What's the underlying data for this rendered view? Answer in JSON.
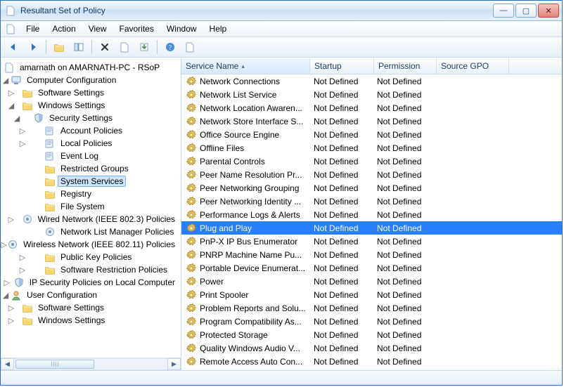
{
  "window": {
    "title": "Resultant Set of Policy"
  },
  "menu": {
    "items": [
      "File",
      "Action",
      "View",
      "Favorites",
      "Window",
      "Help"
    ]
  },
  "toolbar": {
    "back": "Back",
    "forward": "Forward",
    "up": "Up One Level",
    "show_tree": "Show/Hide Console Tree",
    "delete": "Delete",
    "properties": "Properties",
    "export": "Export List",
    "help": "Help",
    "about": "About"
  },
  "tree": {
    "root": "amarnath on AMARNATH-PC - RSoP",
    "computer_configuration": "Computer Configuration",
    "software_settings": "Software Settings",
    "windows_settings": "Windows Settings",
    "security_settings": "Security Settings",
    "account_policies": "Account Policies",
    "local_policies": "Local Policies",
    "event_log": "Event Log",
    "restricted_groups": "Restricted Groups",
    "system_services": "System Services",
    "registry": "Registry",
    "file_system": "File System",
    "wired_network": "Wired Network (IEEE 802.3) Policies",
    "net_list_mgr": "Network List Manager Policies",
    "wireless_network": "Wireless Network (IEEE 802.11) Policies",
    "public_key": "Public Key Policies",
    "software_restriction": "Software Restriction Policies",
    "ip_security": "IP Security Policies on Local Computer",
    "user_configuration": "User Configuration"
  },
  "columns": {
    "service_name": "Service Name",
    "startup": "Startup",
    "permission": "Permission",
    "source_gpo": "Source GPO",
    "widths": {
      "service_name": 170,
      "startup": 78,
      "permission": 76,
      "source_gpo": 90
    }
  },
  "services": [
    {
      "name": "Network Connections",
      "startup": "Not Defined",
      "permission": "Not Defined"
    },
    {
      "name": "Network List Service",
      "startup": "Not Defined",
      "permission": "Not Defined"
    },
    {
      "name": "Network Location Awaren...",
      "startup": "Not Defined",
      "permission": "Not Defined"
    },
    {
      "name": "Network Store Interface S...",
      "startup": "Not Defined",
      "permission": "Not Defined"
    },
    {
      "name": "Office Source Engine",
      "startup": "Not Defined",
      "permission": "Not Defined"
    },
    {
      "name": "Offline Files",
      "startup": "Not Defined",
      "permission": "Not Defined"
    },
    {
      "name": "Parental Controls",
      "startup": "Not Defined",
      "permission": "Not Defined"
    },
    {
      "name": "Peer Name Resolution Pr...",
      "startup": "Not Defined",
      "permission": "Not Defined"
    },
    {
      "name": "Peer Networking Grouping",
      "startup": "Not Defined",
      "permission": "Not Defined"
    },
    {
      "name": "Peer Networking Identity ...",
      "startup": "Not Defined",
      "permission": "Not Defined"
    },
    {
      "name": "Performance Logs & Alerts",
      "startup": "Not Defined",
      "permission": "Not Defined"
    },
    {
      "name": "Plug and Play",
      "startup": "Not Defined",
      "permission": "Not Defined",
      "selected": true
    },
    {
      "name": "PnP-X IP Bus Enumerator",
      "startup": "Not Defined",
      "permission": "Not Defined"
    },
    {
      "name": "PNRP Machine Name Pu...",
      "startup": "Not Defined",
      "permission": "Not Defined"
    },
    {
      "name": "Portable Device Enumerat...",
      "startup": "Not Defined",
      "permission": "Not Defined"
    },
    {
      "name": "Power",
      "startup": "Not Defined",
      "permission": "Not Defined"
    },
    {
      "name": "Print Spooler",
      "startup": "Not Defined",
      "permission": "Not Defined"
    },
    {
      "name": "Problem Reports and Solu...",
      "startup": "Not Defined",
      "permission": "Not Defined"
    },
    {
      "name": "Program Compatibility As...",
      "startup": "Not Defined",
      "permission": "Not Defined"
    },
    {
      "name": "Protected Storage",
      "startup": "Not Defined",
      "permission": "Not Defined"
    },
    {
      "name": "Quality Windows Audio V...",
      "startup": "Not Defined",
      "permission": "Not Defined"
    },
    {
      "name": "Remote Access Auto Con...",
      "startup": "Not Defined",
      "permission": "Not Defined"
    }
  ]
}
